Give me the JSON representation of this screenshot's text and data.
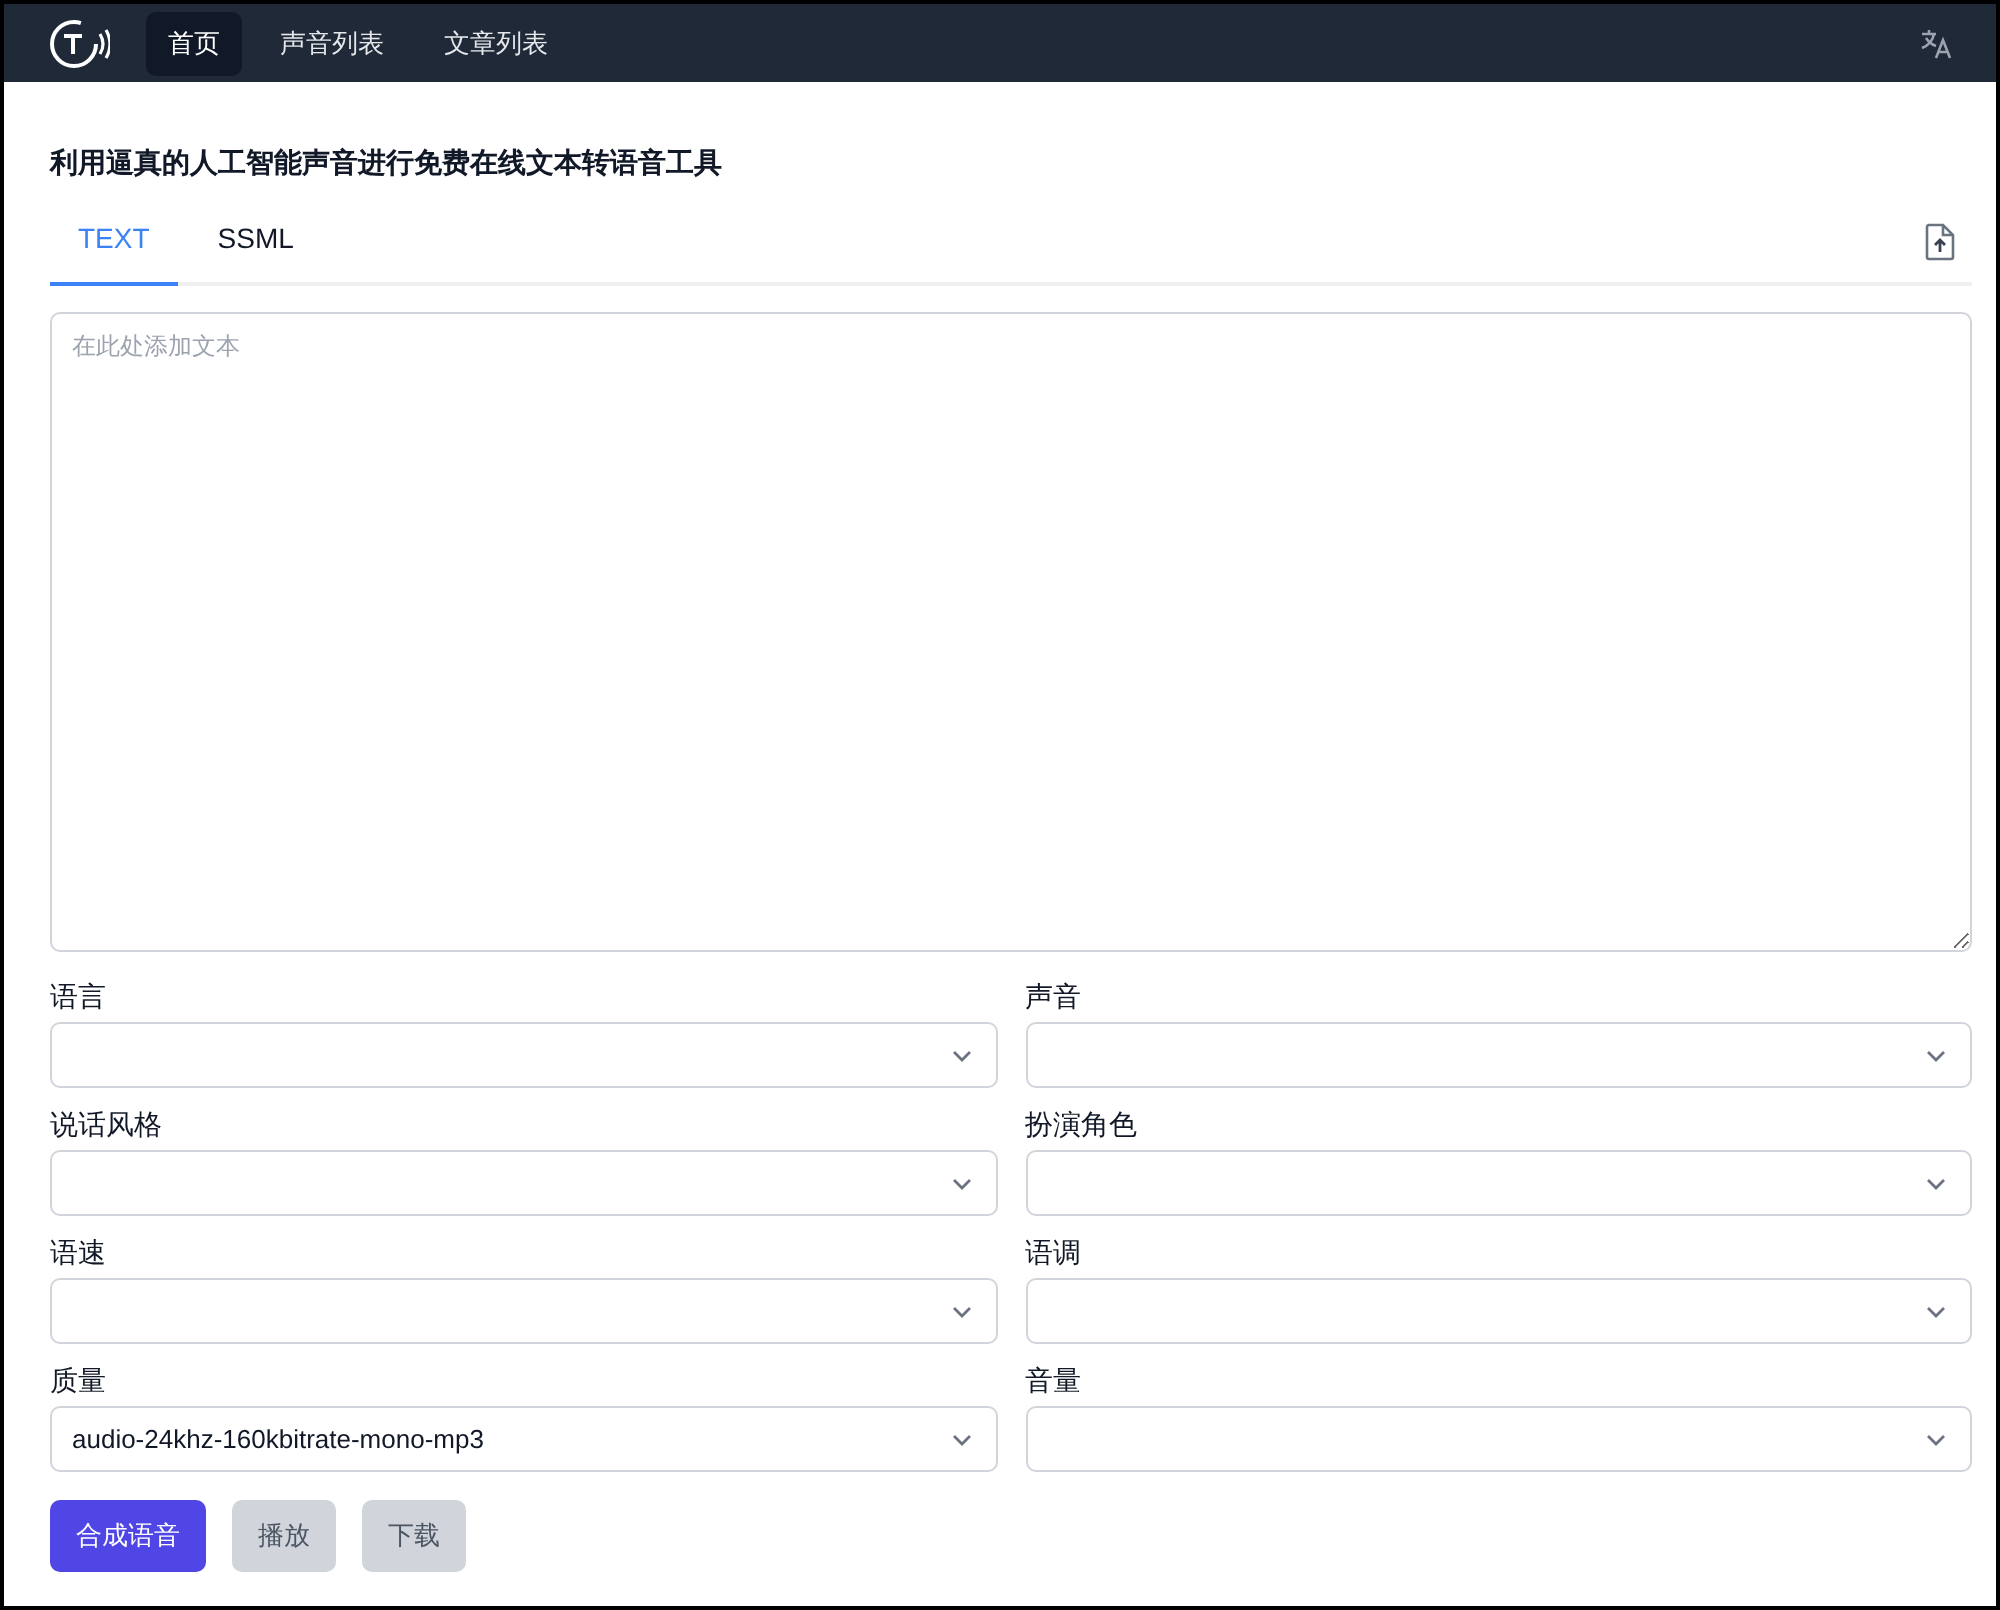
{
  "nav": {
    "items": [
      {
        "label": "首页",
        "selected": true
      },
      {
        "label": "声音列表",
        "selected": false
      },
      {
        "label": "文章列表",
        "selected": false
      }
    ]
  },
  "title": "利用逼真的人工智能声音进行免费在线文本转语音工具",
  "tabs": [
    {
      "label": "TEXT",
      "selected": true
    },
    {
      "label": "SSML",
      "selected": false
    }
  ],
  "editor": {
    "placeholder": "在此处添加文本"
  },
  "fields": [
    {
      "label": "语言"
    },
    {
      "label": "声音"
    },
    {
      "label": "说话风格"
    },
    {
      "label": "扮演角色"
    },
    {
      "label": "语速"
    },
    {
      "label": "语调"
    },
    {
      "label": "质量",
      "value": "audio-24khz-160kbitrate-mono-mp3"
    },
    {
      "label": "音量"
    }
  ],
  "buttons": [
    {
      "label": "合成语音",
      "disabled": false
    },
    {
      "label": "播放",
      "disabled": true
    },
    {
      "label": "下载",
      "disabled": true
    }
  ]
}
